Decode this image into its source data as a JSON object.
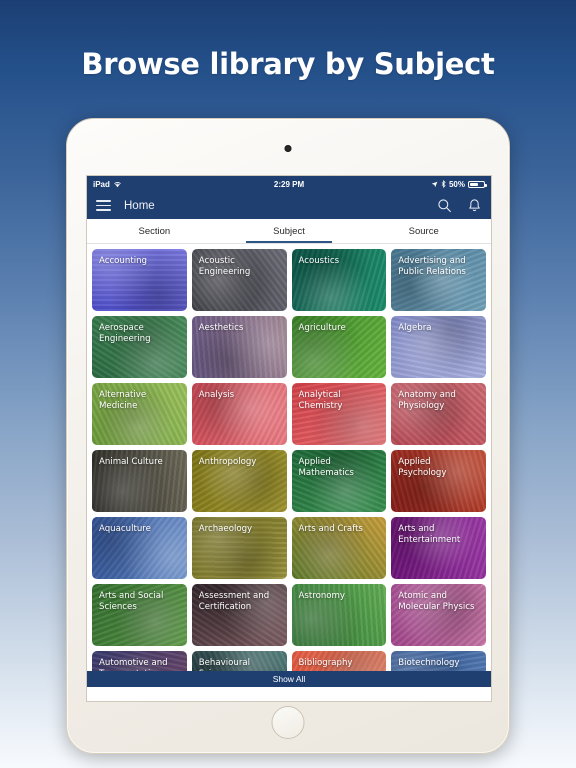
{
  "headline": "Browse library by Subject",
  "device": {
    "status_bar": {
      "carrier": "iPad",
      "wifi_icon": "wifi-icon",
      "time": "2:29 PM",
      "location_icon": "location-arrow-icon",
      "bluetooth_icon": "bluetooth-icon",
      "battery_percent": "50%"
    }
  },
  "navbar": {
    "menu_icon": "hamburger-menu-icon",
    "title": "Home",
    "search_icon": "search-icon",
    "notifications_icon": "bell-icon"
  },
  "tabs": [
    {
      "label": "Section",
      "active": false
    },
    {
      "label": "Subject",
      "active": true
    },
    {
      "label": "Source",
      "active": false
    }
  ],
  "footer": {
    "show_all_label": "Show All"
  },
  "colors": {
    "brand_navy": "#1f3f71",
    "tab_underline": "#2f5584",
    "page_gradient_top": "#1b3f74",
    "page_gradient_bottom": "#f7fafd"
  },
  "subjects": [
    {
      "label": "Accounting",
      "color": "#4a49c9",
      "c2": "#7b7ae0"
    },
    {
      "label": "Acoustic Engineering",
      "color": "#3c3c43",
      "c2": "#6d6d78"
    },
    {
      "label": "Acoustics",
      "color": "#0f5c4e",
      "c2": "#1d8f6c"
    },
    {
      "label": "Advertising and Public Relations",
      "color": "#4d7f9b",
      "c2": "#74a3bb"
    },
    {
      "label": "Aerospace Engineering",
      "color": "#2c6b42",
      "c2": "#4a8f5c"
    },
    {
      "label": "Aesthetics",
      "color": "#6a5a87",
      "c2": "#9b7f8e"
    },
    {
      "label": "Agriculture",
      "color": "#3d8b2a",
      "c2": "#67b63f"
    },
    {
      "label": "Algebra",
      "color": "#8189c8",
      "c2": "#aab2e0"
    },
    {
      "label": "Alternative Medicine",
      "color": "#6d9b3c",
      "c2": "#9cc45e"
    },
    {
      "label": "Analysis",
      "color": "#d94f5c",
      "c2": "#ec7f86"
    },
    {
      "label": "Analytical Chemistry",
      "color": "#d5424a",
      "c2": "#ec7074"
    },
    {
      "label": "Anatomy and Physiology",
      "color": "#b33f4c",
      "c2": "#cf6c74"
    },
    {
      "label": "Animal Culture",
      "color": "#2b2b26",
      "c2": "#6e6a5a"
    },
    {
      "label": "Anthropology",
      "color": "#7d7416",
      "c2": "#a89c34"
    },
    {
      "label": "Applied Mathematics",
      "color": "#1f6b39",
      "c2": "#3a9152"
    },
    {
      "label": "Applied Psychology",
      "color": "#8c1f1a",
      "c2": "#c0482f"
    },
    {
      "label": "Aquaculture",
      "color": "#3a5ea8",
      "c2": "#6a8fc9"
    },
    {
      "label": "Archaeology",
      "color": "#6e6a1d",
      "c2": "#9b9440"
    },
    {
      "label": "Arts and Crafts",
      "color": "#5d7a2a",
      "c2": "#c99f3c"
    },
    {
      "label": "Arts and Entertainment",
      "color": "#71147e",
      "c2": "#9c3aa6"
    },
    {
      "label": "Arts and Social Sciences",
      "color": "#33702f",
      "c2": "#5f9c49"
    },
    {
      "label": "Assessment and Certification",
      "color": "#33262c",
      "c2": "#7b5a5f"
    },
    {
      "label": "Astronomy",
      "color": "#2f7a33",
      "c2": "#63ae56"
    },
    {
      "label": "Atomic and Molecular Physics",
      "color": "#a0448b",
      "c2": "#c977a7"
    },
    {
      "label": "Automotive and Transportation Engineering",
      "color": "#3a3c6e",
      "c2": "#75496a"
    },
    {
      "label": "Behavioural Sciences",
      "color": "#1a2630",
      "c2": "#4e7c78"
    },
    {
      "label": "Bibliography",
      "color": "#e2553c",
      "c2": "#f08468"
    },
    {
      "label": "Biotechnology",
      "color": "#2a4f8c",
      "c2": "#5b82bb"
    }
  ]
}
